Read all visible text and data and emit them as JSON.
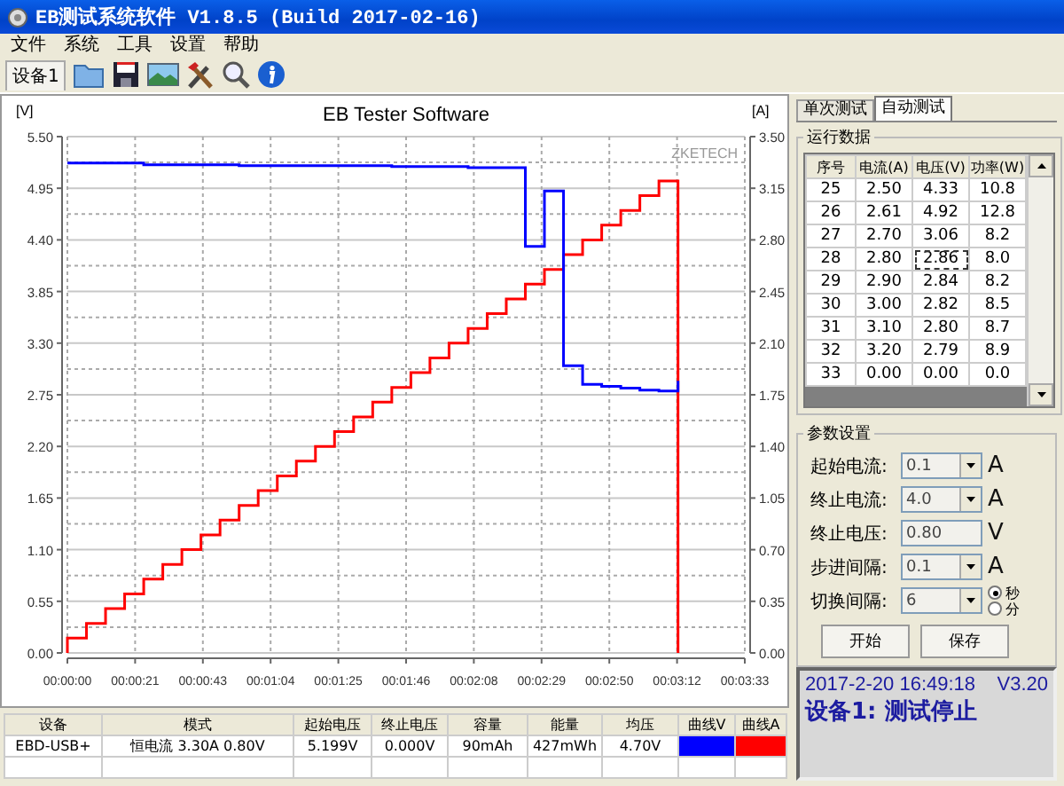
{
  "window": {
    "title": "EB测试系统软件 V1.8.5 (Build 2017-02-16)"
  },
  "menu": [
    "文件",
    "系统",
    "工具",
    "设置",
    "帮助"
  ],
  "toolbar": {
    "device_tab": "设备1"
  },
  "chart": {
    "chart_data": {
      "type": "line",
      "title": "EB Tester Software",
      "ylabel": "[V]",
      "y2label": "[A]",
      "x": [
        0,
        0,
        6,
        6,
        12,
        12,
        18,
        18,
        24,
        24,
        30,
        30,
        36,
        36,
        42,
        42,
        48,
        48,
        54,
        54,
        60,
        60,
        66,
        66,
        72,
        72,
        78,
        78,
        84,
        84,
        90,
        90,
        96,
        96,
        102,
        102,
        108,
        108,
        114,
        114,
        120,
        120,
        126,
        126,
        132,
        132,
        138,
        138,
        144,
        144,
        150,
        150,
        156,
        156,
        162,
        162,
        168,
        168,
        174,
        174,
        180,
        180,
        186,
        186,
        192,
        192
      ],
      "grid": true,
      "xlim": [
        0,
        213
      ],
      "ylim": [
        0,
        5.5
      ],
      "y2lim": [
        0,
        3.5
      ],
      "series": [
        {
          "color": "#0000ff",
          "values": [
            null,
            5.22,
            5.22,
            5.22,
            5.22,
            5.22,
            5.22,
            5.22,
            5.22,
            5.2,
            5.2,
            5.2,
            5.2,
            5.2,
            5.2,
            5.2,
            5.2,
            5.2,
            5.2,
            5.19,
            5.19,
            5.19,
            5.19,
            5.19,
            5.19,
            5.19,
            5.19,
            5.19,
            5.19,
            5.19,
            5.19,
            5.19,
            5.19,
            5.19,
            5.19,
            5.18,
            5.18,
            5.18,
            5.18,
            5.18,
            5.18,
            5.18,
            5.18,
            5.17,
            5.17,
            5.17,
            5.17,
            5.17,
            5.17,
            4.33,
            4.33,
            4.92,
            4.92,
            3.06,
            3.06,
            2.86,
            2.86,
            2.84,
            2.84,
            2.82,
            2.82,
            2.8,
            2.8,
            2.79,
            2.79,
            2.9
          ]
        },
        {
          "axis": "y2",
          "color": "#ff0000",
          "values": [
            0,
            0.1,
            0.1,
            0.2,
            0.2,
            0.3,
            0.3,
            0.4,
            0.4,
            0.5,
            0.5,
            0.6,
            0.6,
            0.7,
            0.7,
            0.8,
            0.8,
            0.9,
            0.9,
            1.0,
            1.0,
            1.1,
            1.1,
            1.2,
            1.2,
            1.3,
            1.3,
            1.4,
            1.4,
            1.5,
            1.5,
            1.6,
            1.6,
            1.7,
            1.7,
            1.8,
            1.8,
            1.9,
            1.9,
            2.0,
            2.0,
            2.1,
            2.1,
            2.2,
            2.2,
            2.3,
            2.3,
            2.4,
            2.4,
            2.5,
            2.5,
            2.6,
            2.6,
            2.7,
            2.7,
            2.8,
            2.8,
            2.9,
            2.9,
            3.0,
            3.0,
            3.1,
            3.1,
            3.2,
            3.2,
            0
          ]
        }
      ],
      "xticks": [
        {
          "value": 0,
          "label": "00:00:00"
        },
        {
          "value": 21.3,
          "label": "00:00:21"
        },
        {
          "value": 42.6,
          "label": "00:00:43"
        },
        {
          "value": 63.9,
          "label": "00:01:04"
        },
        {
          "value": 85.2,
          "label": "00:01:25"
        },
        {
          "value": 106.5,
          "label": "00:01:46"
        },
        {
          "value": 127.8,
          "label": "00:02:08"
        },
        {
          "value": 149.1,
          "label": "00:02:29"
        },
        {
          "value": 170.4,
          "label": "00:02:50"
        },
        {
          "value": 191.7,
          "label": "00:03:12"
        },
        {
          "value": 213,
          "label": "00:03:33"
        }
      ],
      "yticks": [
        {
          "value": 0,
          "label": "0.00"
        },
        {
          "value": 0.55,
          "label": "0.55"
        },
        {
          "value": 1.1,
          "label": "1.10"
        },
        {
          "value": 1.65,
          "label": "1.65"
        },
        {
          "value": 2.2,
          "label": "2.20"
        },
        {
          "value": 2.75,
          "label": "2.75"
        },
        {
          "value": 3.3,
          "label": "3.30"
        },
        {
          "value": 3.85,
          "label": "3.85"
        },
        {
          "value": 4.4,
          "label": "4.40"
        },
        {
          "value": 4.95,
          "label": "4.95"
        },
        {
          "value": 5.5,
          "label": "5.50"
        }
      ],
      "y2ticks": [
        {
          "value": 0,
          "label": "0.00"
        },
        {
          "value": 0.35,
          "label": "0.35"
        },
        {
          "value": 0.7,
          "label": "0.70"
        },
        {
          "value": 1.05,
          "label": "1.05"
        },
        {
          "value": 1.4,
          "label": "1.40"
        },
        {
          "value": 1.75,
          "label": "1.75"
        },
        {
          "value": 2.1,
          "label": "2.10"
        },
        {
          "value": 2.45,
          "label": "2.45"
        },
        {
          "value": 2.8,
          "label": "2.80"
        },
        {
          "value": 3.15,
          "label": "3.15"
        },
        {
          "value": 3.5,
          "label": "3.50"
        }
      ],
      "annotations": [
        {
          "text": "ZKETECH"
        }
      ]
    }
  },
  "summary_table": {
    "columns": [
      "设备",
      "模式",
      "起始电压",
      "终止电压",
      "容量",
      "能量",
      "均压",
      "曲线V",
      "曲线A"
    ],
    "rows": [
      [
        {
          "kind": "text",
          "text": "EBD-USB+"
        },
        {
          "kind": "text",
          "text": "恒电流  3.30A  0.80V"
        },
        {
          "kind": "text",
          "text": "5.199V"
        },
        {
          "kind": "text",
          "text": "0.000V"
        },
        {
          "kind": "text",
          "text": "90mAh"
        },
        {
          "kind": "text",
          "text": "427mWh"
        },
        {
          "kind": "text",
          "text": "4.70V"
        },
        {
          "kind": "swatch",
          "color": "#0000ff"
        },
        {
          "kind": "swatch",
          "color": "#ff0000"
        }
      ]
    ]
  },
  "side": {
    "tabs": [
      {
        "label": "单次测试",
        "selected": false
      },
      {
        "label": "自动测试",
        "selected": true
      }
    ],
    "run_data": {
      "title": "运行数据",
      "columns": [
        "序号",
        "电流(A)",
        "电压(V)",
        "功率(W)"
      ],
      "rows": [
        {
          "cells": [
            "25",
            "2.50",
            "4.33",
            "10.8"
          ],
          "selected": false
        },
        {
          "cells": [
            "26",
            "2.61",
            "4.92",
            "12.8"
          ],
          "selected": false
        },
        {
          "cells": [
            "27",
            "2.70",
            "3.06",
            "8.2"
          ],
          "selected": false
        },
        {
          "cells": [
            "28",
            "2.80",
            "2.86",
            "8.0"
          ],
          "selected": true
        },
        {
          "cells": [
            "29",
            "2.90",
            "2.84",
            "8.2"
          ],
          "selected": false
        },
        {
          "cells": [
            "30",
            "3.00",
            "2.82",
            "8.5"
          ],
          "selected": false
        },
        {
          "cells": [
            "31",
            "3.10",
            "2.80",
            "8.7"
          ],
          "selected": false
        },
        {
          "cells": [
            "32",
            "3.20",
            "2.79",
            "8.9"
          ],
          "selected": false
        },
        {
          "cells": [
            "33",
            "0.00",
            "0.00",
            "0.0"
          ],
          "selected": false
        }
      ]
    },
    "params": {
      "title": "参数设置",
      "rows": [
        {
          "kind": "dropdown",
          "label": "起始电流:",
          "value": "0.1",
          "unit": "A"
        },
        {
          "kind": "dropdown",
          "label": "终止电流:",
          "value": "4.0",
          "unit": "A"
        },
        {
          "kind": "text",
          "label": "终止电压:",
          "value": "0.80",
          "unit": "V"
        },
        {
          "kind": "dropdown",
          "label": "步进间隔:",
          "value": "0.1",
          "unit": "A"
        },
        {
          "kind": "dropdown",
          "label": "切换间隔:",
          "value": "6",
          "options": [
            {
              "label": "秒",
              "selected": true
            },
            {
              "label": "分",
              "selected": false
            }
          ]
        }
      ],
      "buttons": [
        "开始",
        "保存"
      ]
    },
    "status": {
      "datetime": "2017-2-20 16:49:18",
      "version": "V3.20",
      "message": "设备1: 测试停止"
    }
  }
}
